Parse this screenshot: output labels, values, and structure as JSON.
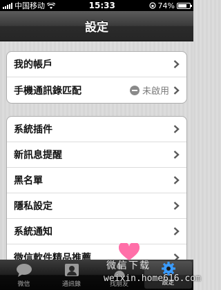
{
  "status_bar": {
    "carrier": "中国移动",
    "time": "15:33",
    "battery_percent": "74%",
    "battery_level": 0.74
  },
  "nav": {
    "title": "設定"
  },
  "group1": [
    {
      "label": "我的帳戶"
    },
    {
      "label": "手機通訊錄匹配",
      "status": "未啟用"
    }
  ],
  "group2": [
    {
      "label": "系統插件"
    },
    {
      "label": "新訊息提醒"
    },
    {
      "label": "黑名單"
    },
    {
      "label": "隱私設定"
    },
    {
      "label": "系統通知"
    },
    {
      "label": "微信軟件精品推薦"
    }
  ],
  "tabs": [
    {
      "label": "微信",
      "icon": "chat-bubble-icon"
    },
    {
      "label": "通訊錄",
      "icon": "contacts-icon"
    },
    {
      "label": "找朋友",
      "icon": "find-friends-icon"
    },
    {
      "label": "設定",
      "icon": "gear-icon",
      "active": true
    }
  ],
  "watermark": {
    "top": "微信下载",
    "bottom": "weixin.home616.com"
  },
  "colors": {
    "nav_bar": "#3a3a3a",
    "background": "#d9d9d9",
    "active_tab_icon": "#3a9bff"
  }
}
